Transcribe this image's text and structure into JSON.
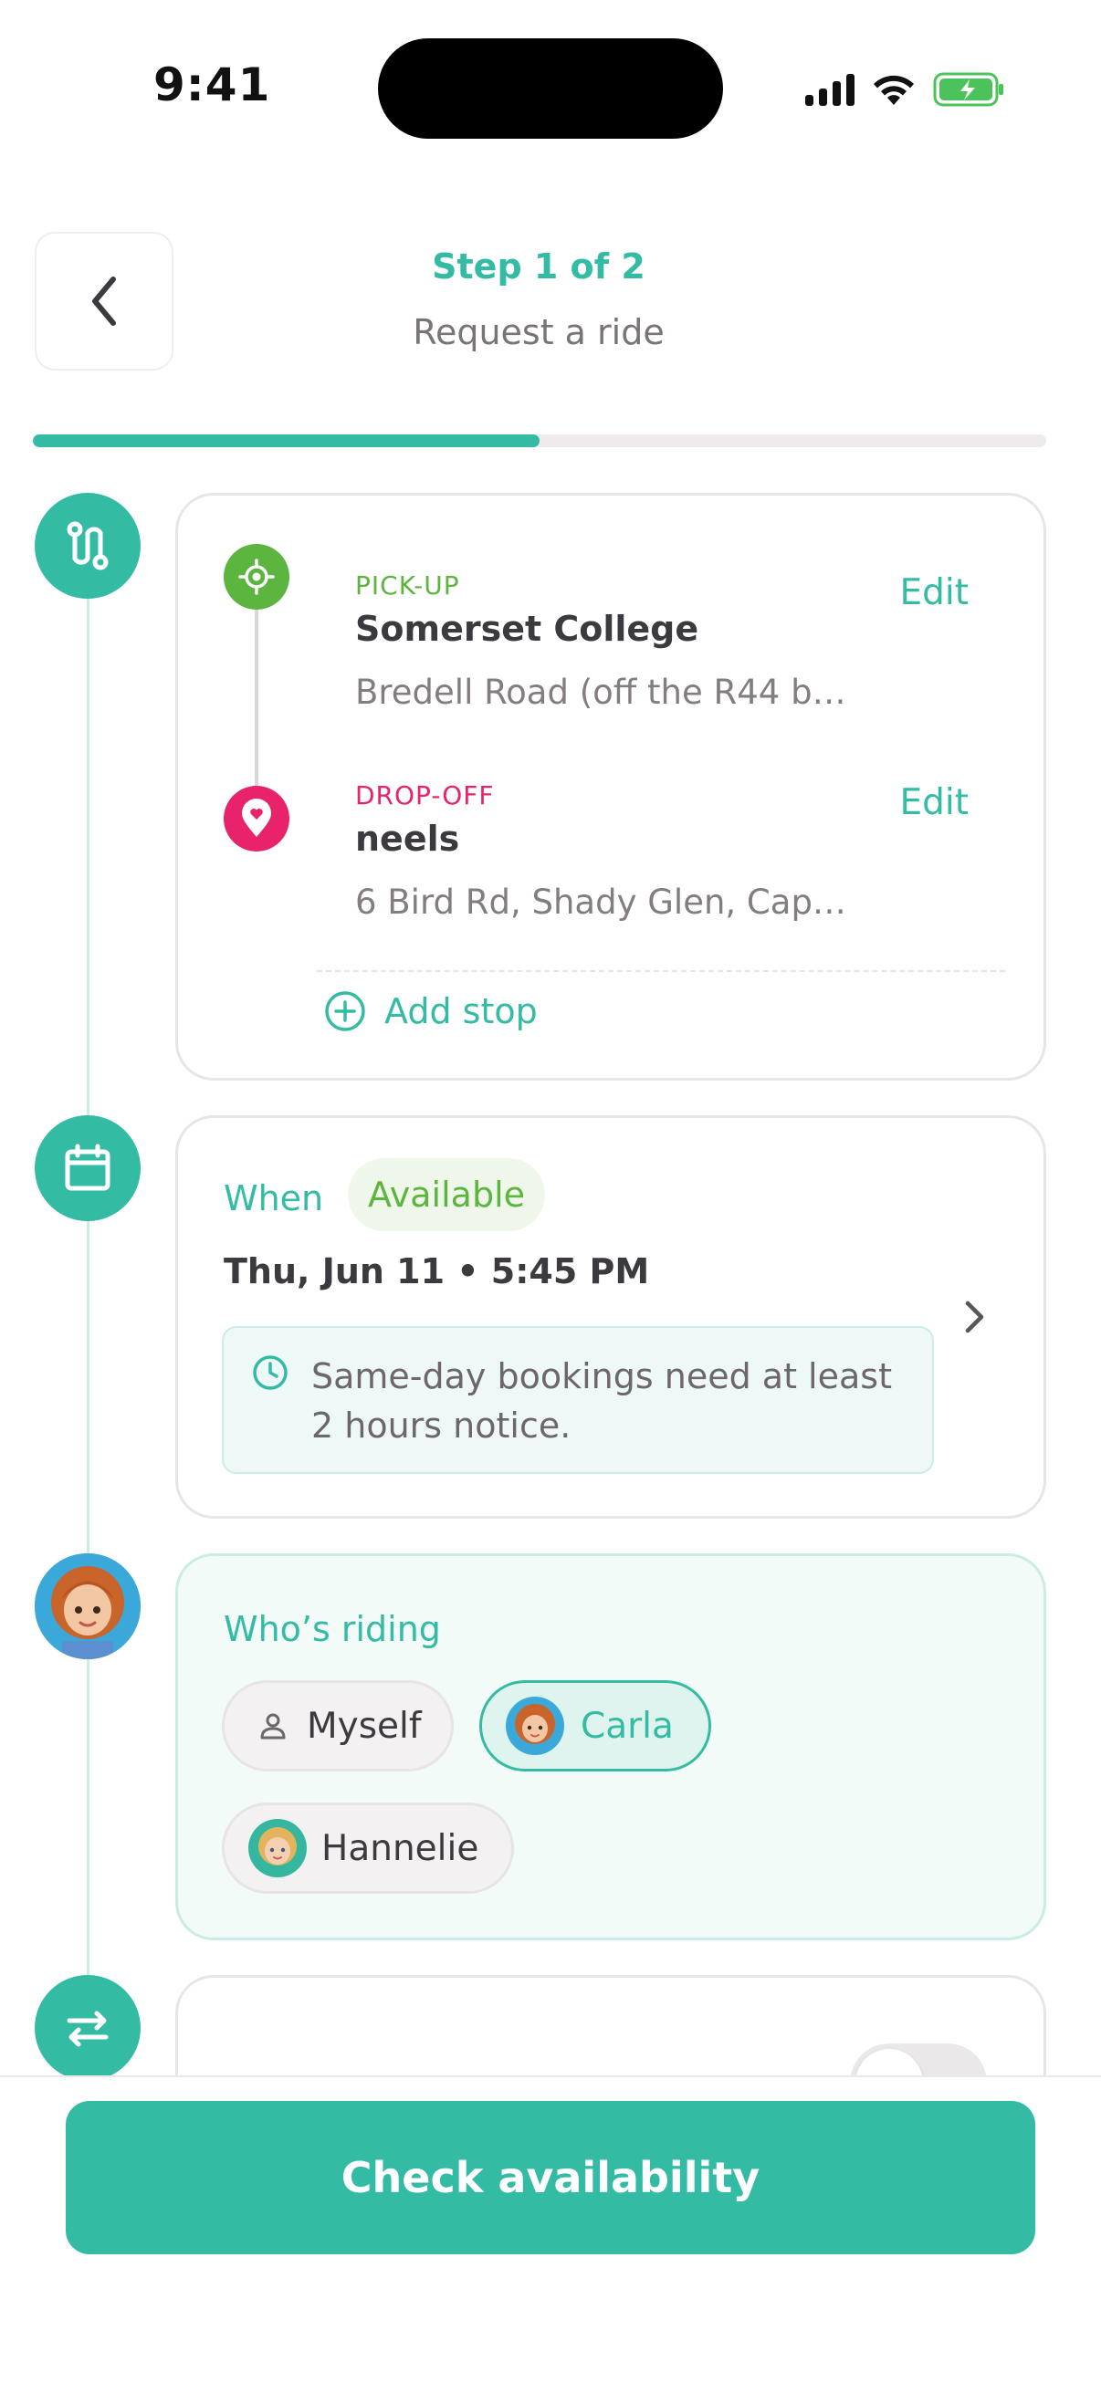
{
  "status_bar": {
    "time": "9:41"
  },
  "header": {
    "step_label": "Step 1 of 2",
    "title": "Request a ride",
    "progress": 0.5
  },
  "route": {
    "pickup": {
      "kind": "PICK-UP",
      "name": "Somerset College",
      "address": "Bredell Road (off the R44 b…",
      "edit_label": "Edit"
    },
    "dropoff": {
      "kind": "DROP-OFF",
      "name": "neels",
      "address": "6 Bird Rd, Shady Glen, Cap…",
      "edit_label": "Edit"
    },
    "add_stop_label": "Add stop"
  },
  "when": {
    "label": "When",
    "badge": "Available",
    "date": "Thu, Jun 11 • 5:45 PM",
    "notice": "Same-day bookings need at least 2 hours notice."
  },
  "riding": {
    "title": "Who’s riding",
    "riders": [
      {
        "name": "Myself",
        "selected": false
      },
      {
        "name": "Carla",
        "selected": true
      },
      {
        "name": "Hannelie",
        "selected": false
      }
    ]
  },
  "return_trip": {
    "toggle_on": false
  },
  "footer": {
    "primary_label": "Check availability"
  },
  "colors": {
    "accent": "#34bba4",
    "pickup": "#5cb53f",
    "dropoff": "#e8236b"
  }
}
